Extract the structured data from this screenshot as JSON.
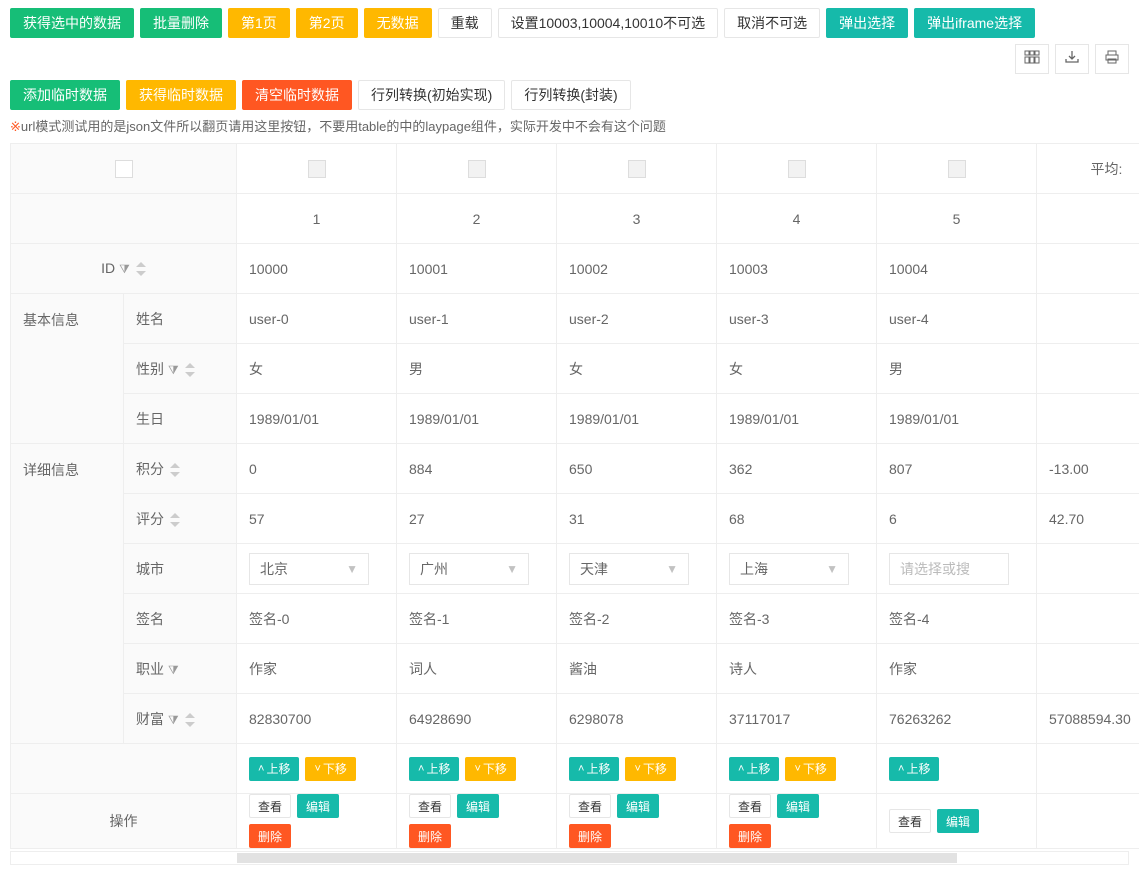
{
  "toolbar": {
    "row1": {
      "get_checked": "获得选中的数据",
      "batch_delete": "批量删除",
      "page1": "第1页",
      "page2": "第2页",
      "no_data": "无数据",
      "reload": "重载",
      "set_disabled": "设置10003,10004,10010不可选",
      "cancel_disabled": "取消不可选",
      "popup_select": "弹出选择",
      "popup_iframe": "弹出iframe选择"
    },
    "row2": {
      "add_temp": "添加临时数据",
      "get_temp": "获得临时数据",
      "clear_temp": "清空临时数据",
      "col_transform_raw": "行列转换(初始实现)",
      "col_transform_wrap": "行列转换(封装)"
    },
    "icons": {
      "cols": "columns-icon",
      "export": "export-icon",
      "print": "print-icon"
    }
  },
  "note_text": "url模式测试用的是json文件所以翻页请用这里按钮，不要用table的中的laypage组件，实际开发中不会有这个问题",
  "headers": {
    "avg_label": "平均:",
    "id_label": "ID",
    "basic_info": "基本信息",
    "detail_info": "详细信息",
    "operate": "操作",
    "name": "姓名",
    "sex": "性别",
    "birthday": "生日",
    "score": "积分",
    "rating": "评分",
    "city": "城市",
    "sign": "签名",
    "job": "职业",
    "wealth": "财富"
  },
  "col_numbers": [
    "1",
    "2",
    "3",
    "4",
    "5"
  ],
  "avg": {
    "score": "-13.00",
    "rating": "42.70",
    "wealth": "57088594.30"
  },
  "rows": [
    {
      "id": "10000",
      "username": "user-0",
      "sex": "女",
      "birthday": "1989/01/01",
      "score": "0",
      "rating": "57",
      "city": "北京",
      "sign": "签名-0",
      "job": "作家",
      "wealth": "82830700"
    },
    {
      "id": "10001",
      "username": "user-1",
      "sex": "男",
      "birthday": "1989/01/01",
      "score": "884",
      "rating": "27",
      "city": "广州",
      "sign": "签名-1",
      "job": "词人",
      "wealth": "64928690"
    },
    {
      "id": "10002",
      "username": "user-2",
      "sex": "女",
      "birthday": "1989/01/01",
      "score": "650",
      "rating": "31",
      "city": "天津",
      "sign": "签名-2",
      "job": "酱油",
      "wealth": "6298078"
    },
    {
      "id": "10003",
      "username": "user-3",
      "sex": "女",
      "birthday": "1989/01/01",
      "score": "362",
      "rating": "68",
      "city": "上海",
      "sign": "签名-3",
      "job": "诗人",
      "wealth": "37117017"
    },
    {
      "id": "10004",
      "username": "user-4",
      "sex": "男",
      "birthday": "1989/01/01",
      "score": "807",
      "rating": "6",
      "city": "",
      "city_placeholder": "请选择或搜",
      "sign": "签名-4",
      "job": "作家",
      "wealth": "76263262"
    }
  ],
  "actions": {
    "move_up": "上移",
    "move_down": "下移",
    "view": "查看",
    "edit": "编辑",
    "delete": "删除"
  }
}
